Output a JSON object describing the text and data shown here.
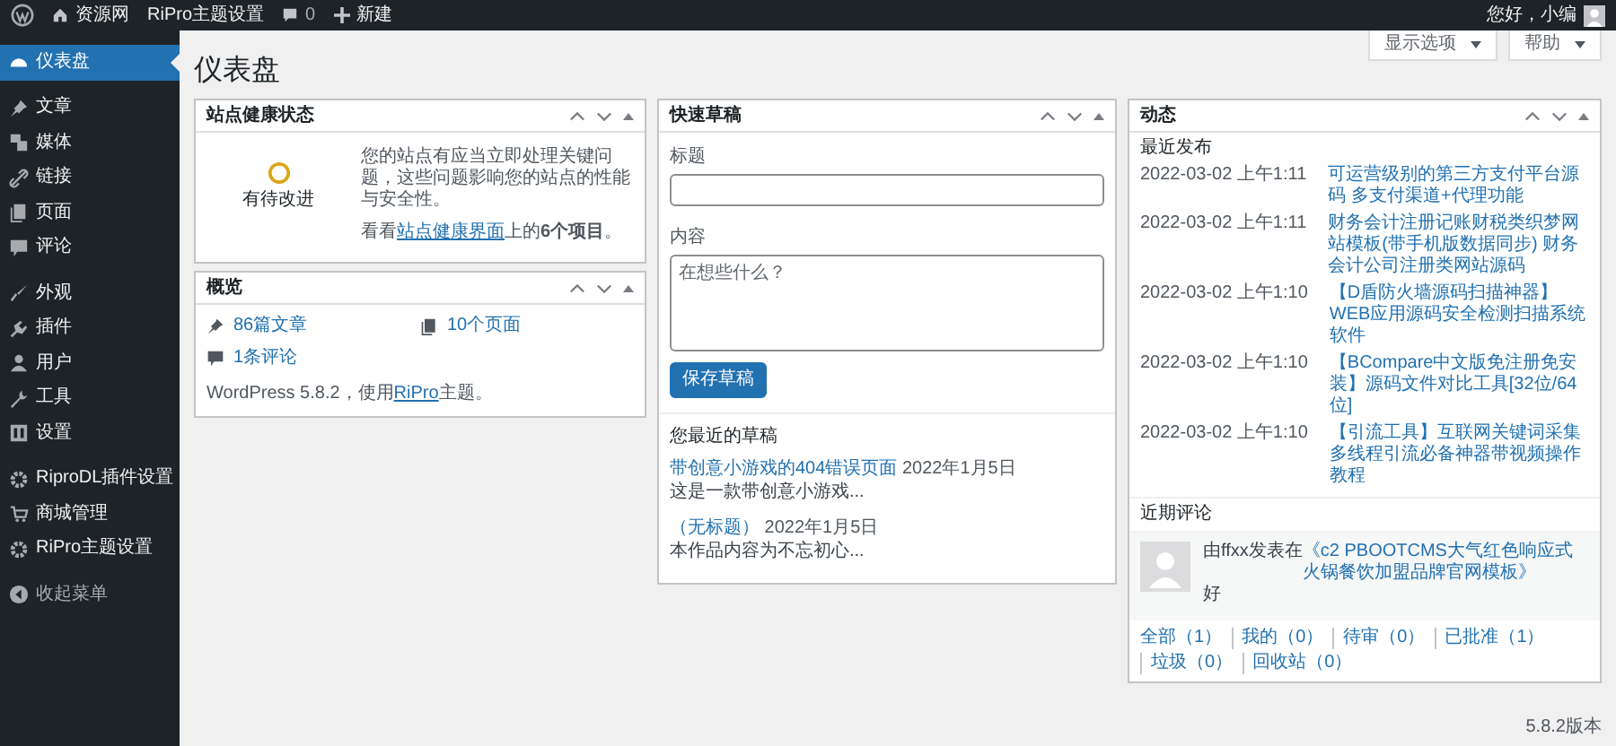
{
  "admin_bar": {
    "site_name": "资源网",
    "theme_settings": "RiPro主题设置",
    "comment_count": "0",
    "new_label": "新建",
    "greeting": "您好，小编"
  },
  "sidebar": {
    "groups": [
      [
        {
          "label": "仪表盘",
          "selected": true
        }
      ],
      [
        {
          "label": "文章",
          "selected": false
        },
        {
          "label": "媒体",
          "selected": false
        },
        {
          "label": "链接",
          "selected": false
        },
        {
          "label": "页面",
          "selected": false
        },
        {
          "label": "评论",
          "selected": false
        }
      ],
      [
        {
          "label": "外观",
          "selected": false
        },
        {
          "label": "插件",
          "selected": false
        },
        {
          "label": "用户",
          "selected": false
        },
        {
          "label": "工具",
          "selected": false
        },
        {
          "label": "设置",
          "selected": false
        }
      ],
      [
        {
          "label": "RiproDL插件设置",
          "selected": false
        },
        {
          "label": "商城管理",
          "selected": false
        },
        {
          "label": "RiPro主题设置",
          "selected": false
        }
      ]
    ],
    "collapse_label": "收起菜单"
  },
  "screen_buttons": [
    "显示选项",
    "帮助"
  ],
  "page_title": "仪表盘",
  "site_health": {
    "title": "站点健康状态",
    "status_label": "有待改进",
    "message": "您的站点有应当立即处理关键问题，这些问题影响您的站点的性能与安全性。",
    "prompt_before": "看看",
    "prompt_link": "站点健康界面",
    "prompt_after": "上的**6个项目**。"
  },
  "overview": {
    "title": "概览",
    "items": [
      {
        "kind": "posts",
        "label": "86篇文章"
      },
      {
        "kind": "pages",
        "label": "10个页面"
      },
      {
        "kind": "comments",
        "label": "1条评论"
      }
    ],
    "footer_before": "WordPress 5.8.2，使用",
    "footer_link": "RiPro",
    "footer_after": "主题。"
  },
  "quick_draft": {
    "title": "快速草稿",
    "title_label": "标题",
    "content_label": "内容",
    "content_placeholder": "在想些什么？",
    "save_button": "保存草稿",
    "drafts_heading": "您最近的草稿",
    "drafts": [
      {
        "title": "带创意小游戏的404错误页面",
        "date": "2022年1月5日",
        "excerpt": "这是一款带创意小游戏..."
      },
      {
        "title": "（无标题）",
        "date": "2022年1月5日",
        "excerpt": "本作品内容为不忘初心..."
      }
    ]
  },
  "activity": {
    "title": "动态",
    "recent_heading": "最近发布",
    "posts": [
      {
        "date": "2022-03-02 上午1:11",
        "title": "可运营级别的第三方支付平台源码 多支付渠道+代理功能"
      },
      {
        "date": "2022-03-02 上午1:11",
        "title": "财务会计注册记账财税类织梦网站模板(带手机版数据同步) 财务会计公司注册类网站源码"
      },
      {
        "date": "2022-03-02 上午1:10",
        "title": "【D盾防火墙源码扫描神器】WEB应用源码安全检测扫描系统软件"
      },
      {
        "date": "2022-03-02 上午1:10",
        "title": "【BCompare中文版免注册免安装】源码文件对比工具[32位/64位]"
      },
      {
        "date": "2022-03-02 上午1:10",
        "title": "【引流工具】互联网关键词采集多线程引流必备神器带视频操作教程"
      }
    ],
    "comments_heading": "近期评论",
    "comments": [
      {
        "author_text": "由ffxx发表在",
        "post_link": "《c2 PBOOTCMS大气红色响应式火锅餐饮加盟品牌官网模板》",
        "text": "好"
      }
    ],
    "filters": [
      "全部（1）",
      "我的（0）",
      "待审（0）",
      "已批准（1）",
      "垃圾（0）",
      "回收站（0）"
    ]
  },
  "footer_version": "5.8.2版本"
}
